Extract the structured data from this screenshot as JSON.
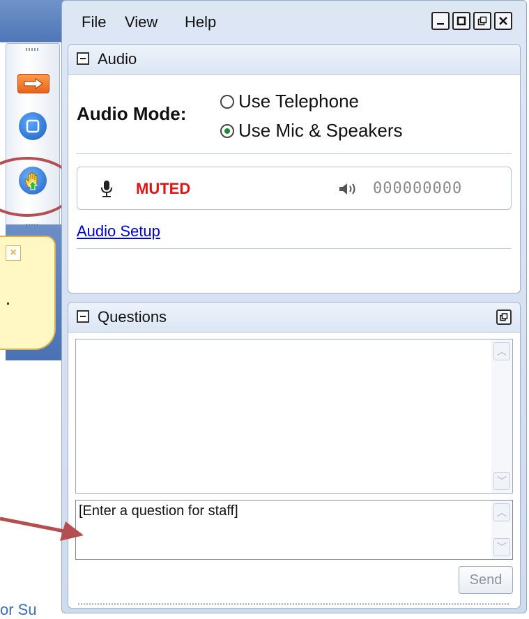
{
  "menu": {
    "file": "File",
    "view": "View",
    "help": "Help"
  },
  "window_controls": {
    "minimize": "_",
    "maximize": "□",
    "restore": "❐",
    "close": "✕"
  },
  "audio": {
    "title": "Audio",
    "mode_label": "Audio Mode:",
    "options": [
      {
        "label": "Use Telephone",
        "selected": false
      },
      {
        "label": "Use Mic & Speakers",
        "selected": true
      }
    ],
    "status": "MUTED",
    "level": "000000000",
    "setup_link": "Audio Setup"
  },
  "questions": {
    "title": "Questions",
    "input_value": "[Enter a question for staff]",
    "send_label": "Send"
  },
  "background": {
    "bottom_text": "or Su"
  },
  "colors": {
    "muted": "#e01414",
    "annotation": "#b54e4e",
    "accent": "#1f8a3b"
  }
}
